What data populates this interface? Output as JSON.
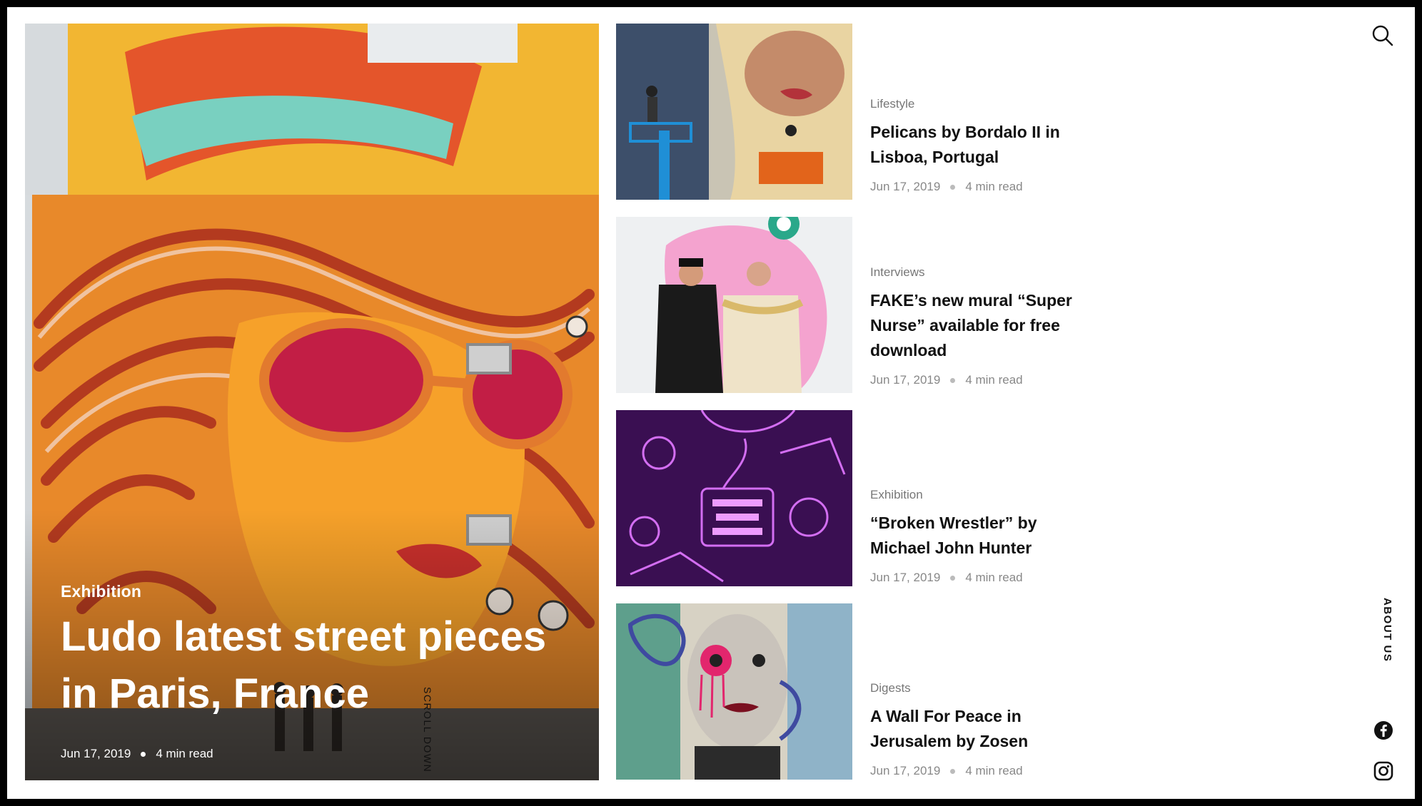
{
  "hero": {
    "category": "Exhibition",
    "title": "Ludo latest street pieces in Paris, France",
    "date": "Jun 17, 2019",
    "read_time": "4 min read",
    "scroll_label": "SCROLL DOWN"
  },
  "articles": [
    {
      "category": "Lifestyle",
      "title": "Pelicans by Bordalo II in Lisboa, Portugal",
      "date": "Jun 17, 2019",
      "read_time": "4 min read"
    },
    {
      "category": "Interviews",
      "title": "FAKE’s new mural “Super Nurse” available for free download",
      "date": "Jun 17, 2019",
      "read_time": "4 min read"
    },
    {
      "category": "Exhibition",
      "title": "“Broken Wrestler” by Michael John Hunter",
      "date": "Jun 17, 2019",
      "read_time": "4 min read"
    },
    {
      "category": "Digests",
      "title": "A Wall For Peace in Jerusalem by Zosen",
      "date": "Jun 17, 2019",
      "read_time": "4 min read"
    }
  ],
  "nav": {
    "about_label": "ABOUT US",
    "search_icon": "search-icon",
    "social_icons": [
      "facebook-icon",
      "instagram-icon"
    ]
  }
}
